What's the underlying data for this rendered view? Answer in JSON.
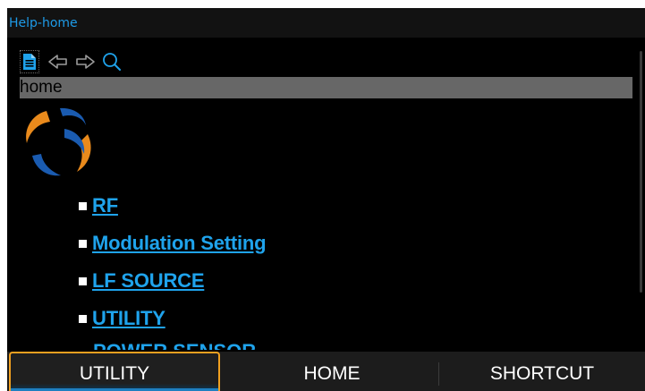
{
  "window": {
    "title": "Help-home"
  },
  "toolbar": {
    "icons": [
      "document-icon",
      "back-arrow-icon",
      "forward-arrow-icon",
      "search-icon"
    ]
  },
  "address_bar": {
    "value": "home"
  },
  "help_links": [
    {
      "label": "RF"
    },
    {
      "label": "Modulation Setting"
    },
    {
      "label": "LF SOURCE"
    },
    {
      "label": "UTILITY"
    }
  ],
  "partial_link": {
    "label": "POWER SENSOR"
  },
  "softkeys": [
    {
      "label": "UTILITY",
      "selected": true
    },
    {
      "label": "HOME",
      "selected": false
    },
    {
      "label": "SHORTCUT",
      "selected": false
    }
  ],
  "colors": {
    "accent": "#1fa3ec",
    "title_text": "#1e9be8",
    "selection_border": "#f0a020",
    "background": "#000000",
    "address_bar": "#676767",
    "logo_orange": "#e98a1c",
    "logo_blue": "#1a5bb0"
  }
}
